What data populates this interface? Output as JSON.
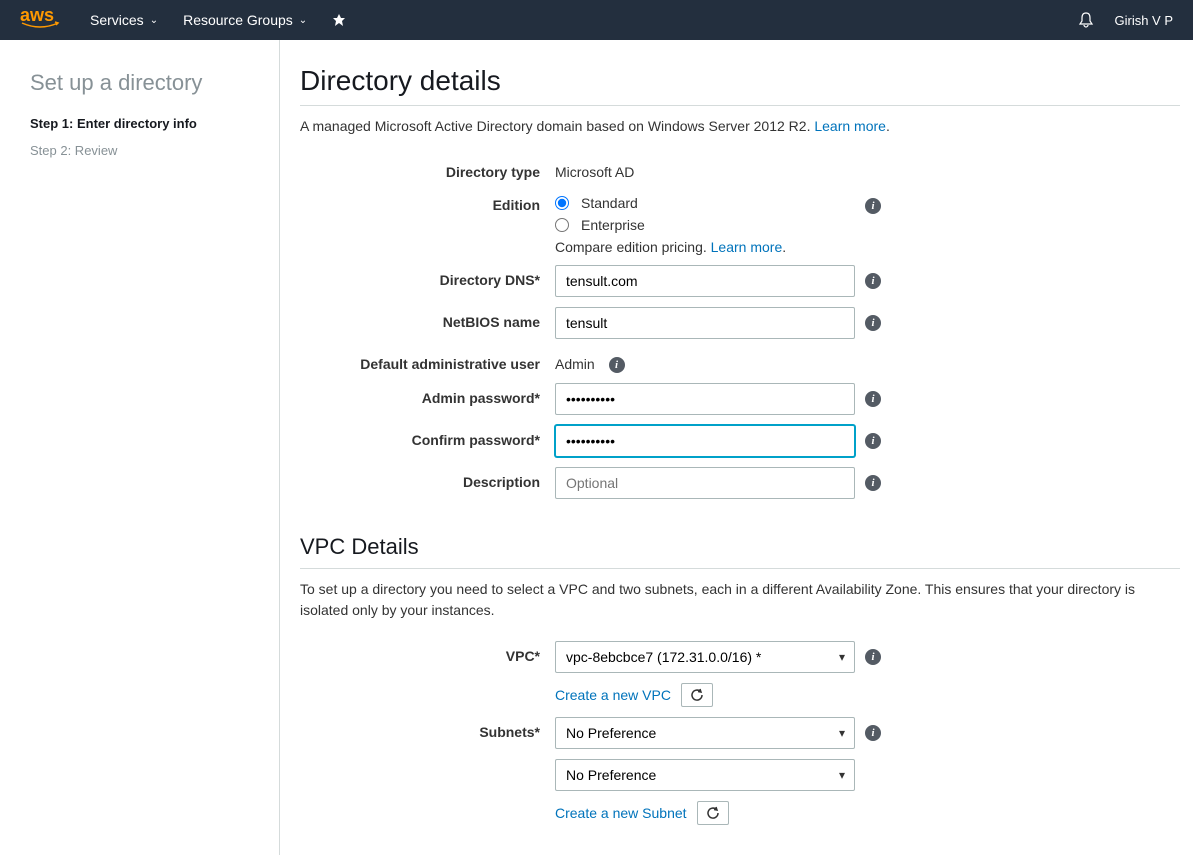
{
  "nav": {
    "logo": "aws",
    "services": "Services",
    "resourceGroups": "Resource Groups",
    "user": "Girish V P"
  },
  "sidebar": {
    "title": "Set up a directory",
    "steps": [
      {
        "label": "Step 1: Enter directory info",
        "active": true
      },
      {
        "label": "Step 2: Review",
        "active": false
      }
    ]
  },
  "section": {
    "title": "Directory details",
    "desc": "A managed Microsoft Active Directory domain based on Windows Server 2012 R2. ",
    "learnMore": "Learn more"
  },
  "form": {
    "directoryType": {
      "label": "Directory type",
      "value": "Microsoft AD"
    },
    "edition": {
      "label": "Edition",
      "options": [
        "Standard",
        "Enterprise"
      ],
      "selected": "Standard",
      "compareText": "Compare edition pricing. ",
      "learnMore": "Learn more"
    },
    "directoryDNS": {
      "label": "Directory DNS*",
      "value": "tensult.com"
    },
    "netbios": {
      "label": "NetBIOS name",
      "value": "tensult"
    },
    "adminUser": {
      "label": "Default administrative user",
      "value": "Admin"
    },
    "adminPassword": {
      "label": "Admin password*",
      "value": "••••••••••"
    },
    "confirmPassword": {
      "label": "Confirm password*",
      "value": "••••••••••"
    },
    "description": {
      "label": "Description",
      "placeholder": "Optional"
    }
  },
  "vpc": {
    "title": "VPC Details",
    "desc": "To set up a directory you need to select a VPC and two subnets, each in a different Availability Zone. This ensures that your directory is isolated only by your instances.",
    "vpcLabel": "VPC*",
    "vpcValue": "vpc-8ebcbce7 (172.31.0.0/16) *",
    "createVpc": "Create a new VPC",
    "subnetsLabel": "Subnets*",
    "subnet1": "No Preference",
    "subnet2": "No Preference",
    "createSubnet": "Create a new Subnet"
  }
}
